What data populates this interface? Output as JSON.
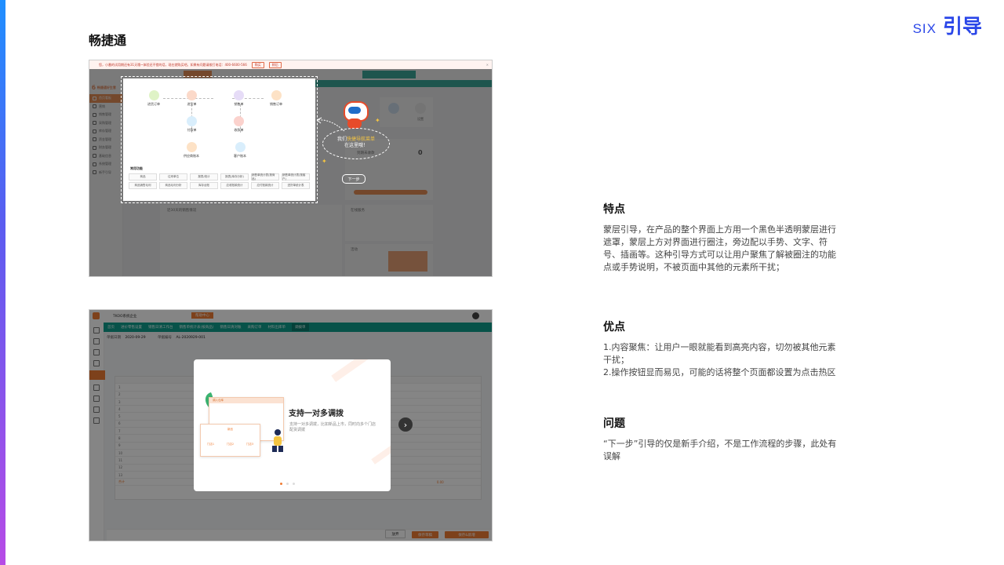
{
  "slide": {
    "number": "SIX",
    "title": "引导"
  },
  "brand": "畅捷通",
  "shot1": {
    "alert": {
      "text": "您，小番的试用期还有31天哦~体验还不错的话，现在就购买吧。如果有问题请拨打电话：400-6600-566",
      "btn_buy": "购买",
      "btn_later": "稍后"
    },
    "logo": "畅捷通好生意",
    "sidebar": [
      "首页看板",
      "营销",
      "销售管理",
      "采购管理",
      "库存管理",
      "资金管理",
      "财务管理",
      "基础信息",
      "系统管理",
      "新手引导"
    ],
    "flow_nodes": [
      "进货订单",
      "进货单",
      "销售单",
      "销售订单",
      "付款单",
      "收款单",
      "供应商账本",
      "客户账本"
    ],
    "quick_label": "常用功能",
    "quick_btns": [
      "商品",
      "往来单位",
      "报表/统计",
      "报表(库存分析)",
      "销售单统计表(按商品)",
      "销售单统计表(按客户)",
      "商品销售毛利",
      "商品毛利分析",
      "库存台账",
      "应收账款统计",
      "应付账款统计",
      "进货单统计表"
    ],
    "bubble_line1": "我们",
    "bubble_highlight": "快捷导航菜单",
    "bubble_line2": "在这里哦！",
    "next_step": "下一步",
    "dim_panel_1": "近30天的销售情况",
    "dim_panel_2": "在线服务",
    "dim_panel_3": "活动",
    "dim_right_top": "到期未收款",
    "dim_right_val": "0",
    "dim_setting": "设置"
  },
  "shot2": {
    "top_company": "TKOO系统企业",
    "top_btn": "帮助中心",
    "tabs": [
      "首页",
      "进价零售设置",
      "销售日清工作台",
      "销售单统计表(按商品)",
      "销售日清对账",
      "采购订单",
      "材料出库单",
      "调拨单"
    ],
    "doc_date_label": "单据日期",
    "doc_date": "2020-09-29",
    "doc_no_label": "单据编号",
    "doc_no": "AL-2020929-001",
    "row_numbers": [
      "1",
      "2",
      "3",
      "4",
      "5",
      "6",
      "7",
      "8",
      "9",
      "10",
      "11",
      "12",
      "13"
    ],
    "total_label": "合计",
    "totals": [
      "0.00",
      "0.00",
      "0.00"
    ],
    "footer_btns": [
      "放弃",
      "保存草稿",
      "保存&新增"
    ],
    "modal": {
      "title": "支持一对多调拨",
      "desc": "支持一对多调拨，比如新品上市，同时向多个门店配货调拨",
      "card_header": "调入仓库",
      "card2_label": "新品",
      "stores": [
        "门店1",
        "门店2",
        "门店3"
      ]
    }
  },
  "features": {
    "heading": "特点",
    "body": "蒙层引导，在产品的整个界面上方用一个黑色半透明蒙层进行遮罩，蒙层上方对界面进行圈注，旁边配以手势、文字、符号、插画等。这种引导方式可以让用户聚焦了解被圈注的功能点或手势说明，不被页面中其他的元素所干扰；"
  },
  "pros": {
    "heading": "优点",
    "item1": "1.内容聚焦：让用户一眼就能看到高亮内容，切勿被其他元素干扰；",
    "item2": "2.操作按钮显而易见，可能的话将整个页面都设置为点击热区"
  },
  "issues": {
    "heading": "问题",
    "body": "“下一步”引导的仅是新手介绍，不是工作流程的步骤，此处有误解"
  },
  "colors": {
    "accent": "#2a46e8",
    "teal": "#0f9e8c",
    "orange": "#f07d34"
  }
}
